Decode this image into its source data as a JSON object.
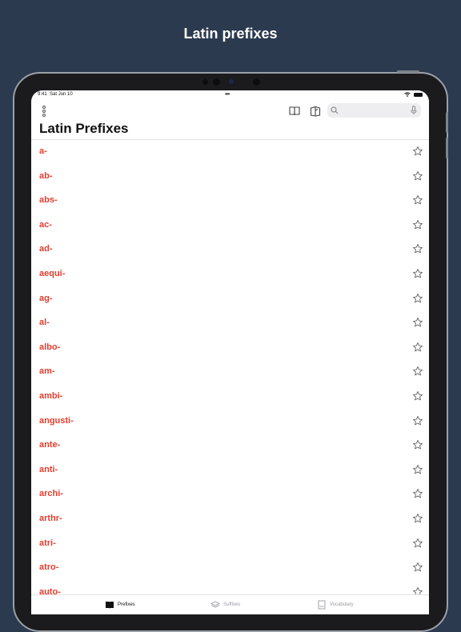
{
  "promo": {
    "title": "Latin prefixes"
  },
  "status_bar": {
    "time": "9:41",
    "date": "Sat Jun 10"
  },
  "toolbar": {
    "icons": [
      "more-icon",
      "book-open-icon",
      "book-share-icon",
      "search-icon",
      "microphone-icon"
    ],
    "search_placeholder": ""
  },
  "page": {
    "title": "Latin Prefixes"
  },
  "list": {
    "items": [
      "a-",
      "ab-",
      "abs-",
      "ac-",
      "ad-",
      "aequi-",
      "ag-",
      "al-",
      "albo-",
      "am-",
      "ambi-",
      "angusti-",
      "ante-",
      "anti-",
      "archi-",
      "arthr-",
      "atri-",
      "atro-",
      "auto-"
    ],
    "star_icon": "star-outline-icon"
  },
  "tabs": [
    {
      "label": "Prefixes",
      "icon": "book-icon",
      "selected": true
    },
    {
      "label": "Suffixes",
      "icon": "stack-icon",
      "selected": false
    },
    {
      "label": "Vocabulary",
      "icon": "document-icon",
      "selected": false
    }
  ],
  "colors": {
    "background": "#2c3a4f",
    "accent": "#e03e2e",
    "tab_selected": "#111111",
    "tab_unselected": "#9a9aa0"
  }
}
